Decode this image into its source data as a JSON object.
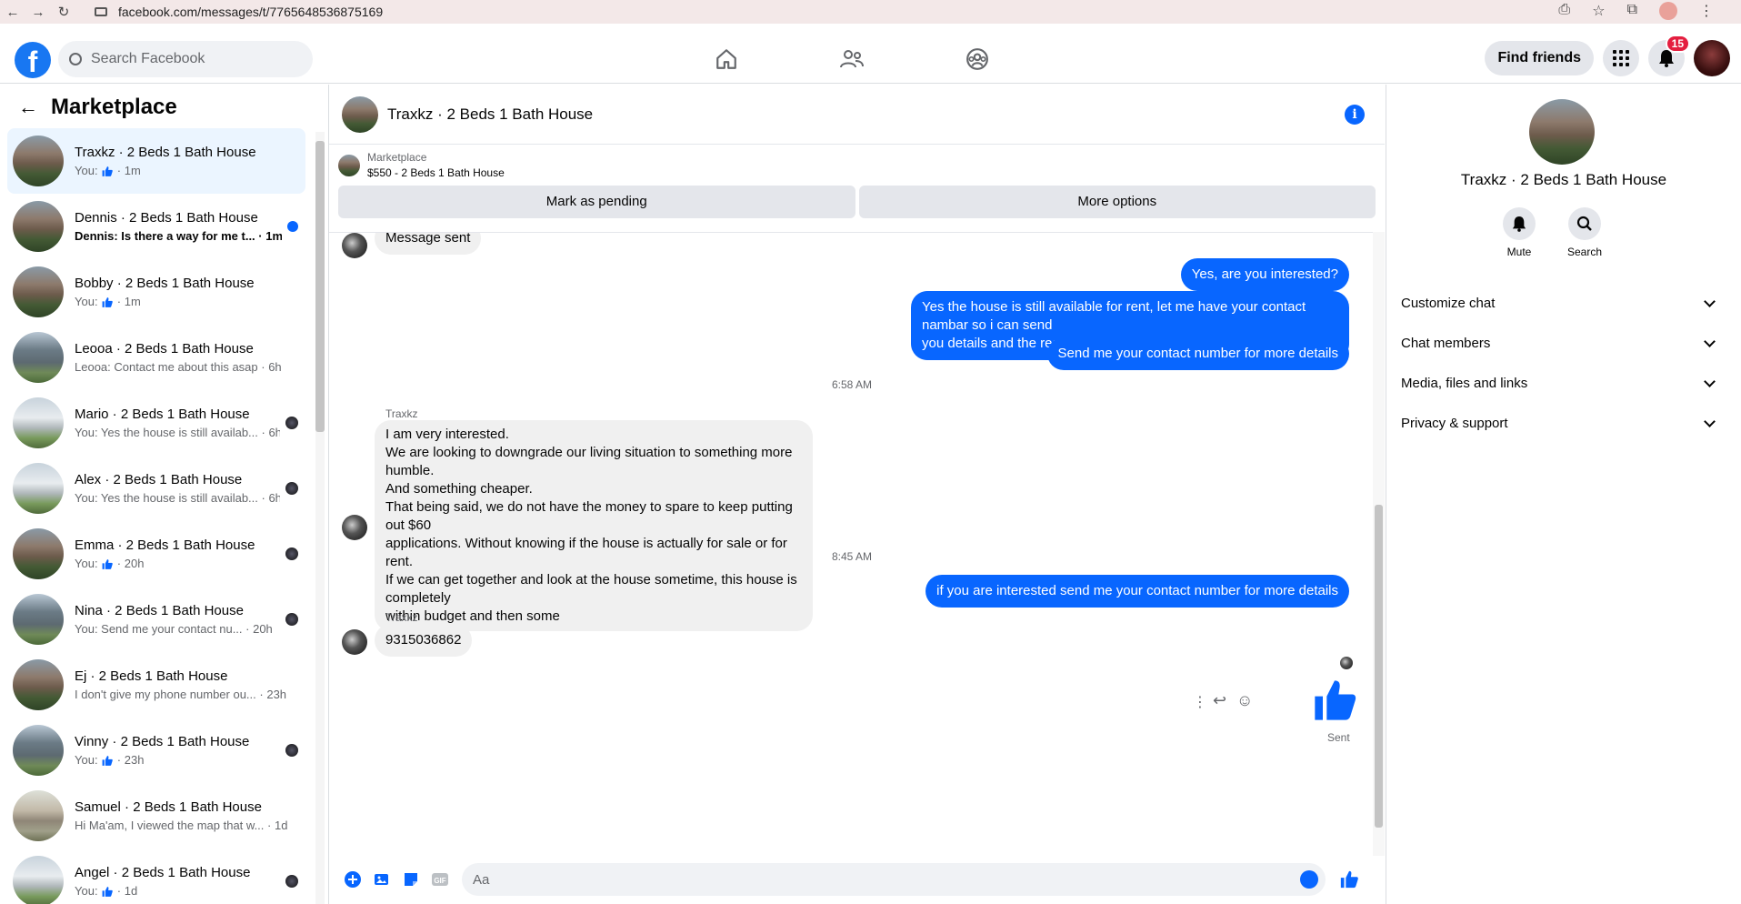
{
  "browser": {
    "url": "facebook.com/messages/t/7765648536875169"
  },
  "header": {
    "logo": "f",
    "search_placeholder": "Search Facebook",
    "find_friends": "Find friends",
    "notifications_count": "15"
  },
  "sidebar": {
    "title": "Marketplace",
    "conversations": [
      {
        "name": "Traxkz · 2 Beds 1 Bath House",
        "preview": "You:",
        "time": "1m",
        "like": true,
        "unread": false,
        "active": true,
        "thumb": "house1"
      },
      {
        "name": "Dennis · 2 Beds 1 Bath House",
        "preview": "Dennis: Is there a way for me t...",
        "time": "1m",
        "like": false,
        "unread": true,
        "active": false,
        "thumb": "house1"
      },
      {
        "name": "Bobby · 2 Beds 1 Bath House",
        "preview": "You:",
        "time": "1m",
        "like": true,
        "unread": false,
        "active": false,
        "thumb": "house1"
      },
      {
        "name": "Leooa · 2 Beds 1 Bath House",
        "preview": "Leooa: Contact me about this asap",
        "time": "6h",
        "like": false,
        "unread": false,
        "active": false,
        "thumb": "house2"
      },
      {
        "name": "Mario · 2 Beds 1 Bath House",
        "preview": "You: Yes the house is still availab...",
        "time": "6h",
        "like": false,
        "unread": false,
        "active": false,
        "thumb": "house3"
      },
      {
        "name": "Alex · 2 Beds 1 Bath House",
        "preview": "You: Yes the house is still availab...",
        "time": "6h",
        "like": false,
        "unread": false,
        "active": false,
        "thumb": "house3"
      },
      {
        "name": "Emma · 2 Beds 1 Bath House",
        "preview": "You:",
        "time": "20h",
        "like": true,
        "unread": false,
        "active": false,
        "thumb": "house1"
      },
      {
        "name": "Nina · 2 Beds 1 Bath House",
        "preview": "You: Send me your contact nu...",
        "time": "20h",
        "like": false,
        "unread": false,
        "active": false,
        "thumb": "house2"
      },
      {
        "name": "Ej · 2 Beds 1 Bath House",
        "preview": "I don't give my phone number ou...",
        "time": "23h",
        "like": false,
        "unread": false,
        "active": false,
        "thumb": "house1"
      },
      {
        "name": "Vinny · 2 Beds 1 Bath House",
        "preview": "You:",
        "time": "23h",
        "like": true,
        "unread": false,
        "active": false,
        "thumb": "house2"
      },
      {
        "name": "Samuel · 2 Beds 1 Bath House",
        "preview": "Hi Ma'am, I viewed the map that w...",
        "time": "1d",
        "like": false,
        "unread": false,
        "active": false,
        "thumb": "house4"
      },
      {
        "name": "Angel · 2 Beds 1 Bath House",
        "preview": "You:",
        "time": "1d",
        "like": true,
        "unread": false,
        "active": false,
        "thumb": "house3"
      }
    ]
  },
  "chat": {
    "title": "Traxkz · 2 Beds 1 Bath House",
    "listing_source": "Marketplace",
    "listing_price_title": "$550 - 2 Beds 1 Bath House",
    "mark_pending": "Mark as pending",
    "more_options": "More options",
    "messages": {
      "m0": "Message sent",
      "m1": "Yes, are you interested?",
      "m2_line1": "Yes the house is still available for rent, let me have your contact nambar so i can send",
      "m2_line2": "you details and the requirements about the house",
      "m3": "Send me your contact number for more details",
      "time1": "6:58 AM",
      "sender1": "Traxkz",
      "m4_lines": [
        "I am very interested.",
        "We are looking to downgrade our living situation to something more humble.",
        "And something cheaper.",
        "That being said, we do not have the money to spare to keep putting out $60",
        "applications. Without knowing if the house is actually for sale or for rent.",
        "If we can get together and look at the house sometime, this house is completely",
        "within budget and then some"
      ],
      "time2": "8:45 AM",
      "m5": "if you are interested send me your contact number for more details",
      "sender2": "Traxkz",
      "m6": "9315036862",
      "status": "Sent"
    },
    "composer_placeholder": "Aa"
  },
  "right_panel": {
    "title": "Traxkz · 2 Beds 1 Bath House",
    "mute": "Mute",
    "search": "Search",
    "menu": [
      "Customize chat",
      "Chat members",
      "Media, files and links",
      "Privacy & support"
    ]
  },
  "colors": {
    "brand": "#1877f2",
    "outgoing_bubble": "#0866ff",
    "incoming_bubble": "#f0f0f0",
    "active_row": "#ebf5ff"
  }
}
